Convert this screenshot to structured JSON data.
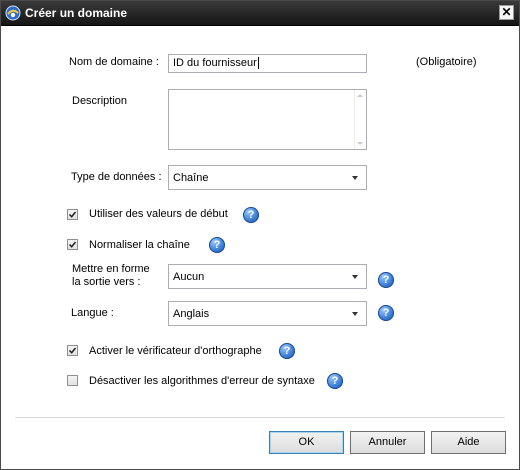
{
  "window": {
    "title": "Créer un domaine",
    "close": "✕",
    "icon": "app-icon"
  },
  "form": {
    "domain_name_label": "Nom de domaine :",
    "domain_name_value": "ID du fournisseur",
    "required_note": "(Obligatoire)",
    "description_label": "Description",
    "description_value": "",
    "data_type_label": "Type de données :",
    "data_type_value": "Chaîne",
    "use_leading_values_label": "Utiliser des valeurs de début",
    "use_leading_values_checked": true,
    "normalize_string_label": "Normaliser la chaîne",
    "normalize_string_checked": true,
    "format_output_label_line1": "Mettre en forme",
    "format_output_label_line2": "la sortie vers :",
    "format_output_value": "Aucun",
    "language_label": "Langue :",
    "language_value": "Anglais",
    "spellchecker_label": "Activer le vérificateur d'orthographe",
    "spellchecker_checked": true,
    "disable_syntax_label": "Désactiver les algorithmes d'erreur de syntaxe",
    "disable_syntax_checked": false,
    "help_glyph": "?"
  },
  "buttons": {
    "ok": "OK",
    "cancel": "Annuler",
    "help": "Aide"
  }
}
